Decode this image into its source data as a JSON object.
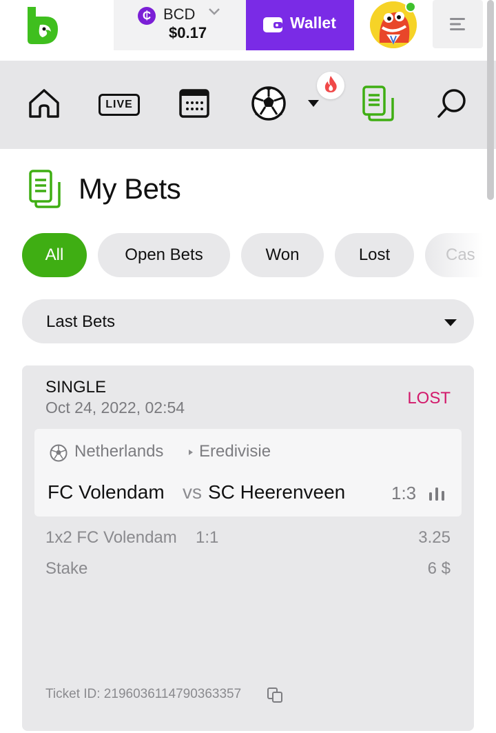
{
  "header": {
    "currency": {
      "symbol": "₵",
      "code": "BCD",
      "amount": "$0.17"
    },
    "wallet_label": "Wallet"
  },
  "nav": {
    "items": [
      "home-icon",
      "live-icon",
      "calendar-icon",
      "soccer-ball-icon",
      "dropdown-caret-icon",
      "my-bets-icon",
      "search-icon"
    ],
    "live_label": "LIVE",
    "hot_badge": "fire-icon"
  },
  "page": {
    "title": "My Bets"
  },
  "filters": {
    "chips": [
      {
        "label": "All",
        "active": true
      },
      {
        "label": "Open Bets",
        "active": false
      },
      {
        "label": "Won",
        "active": false
      },
      {
        "label": "Lost",
        "active": false
      },
      {
        "label": "Cas",
        "active": false
      }
    ],
    "active_color": "#3fae13"
  },
  "dropdown": {
    "selected": "Last Bets"
  },
  "bet": {
    "type": "SINGLE",
    "date": "Oct 24, 2022, 02:54",
    "status": "LOST",
    "status_color": "#d2196b",
    "country": "Netherlands",
    "league": "Eredivisie",
    "home_team": "FC Volendam",
    "vs": "vs",
    "away_team": "SC Heerenveen",
    "score": "1:3",
    "market": "1x2 FC Volendam",
    "pick_score": "1:1",
    "odds": "3.25",
    "stake_label": "Stake",
    "stake_value": "6 $",
    "ticket": "Ticket ID: 219603611479036335​7"
  },
  "colors": {
    "brand_green": "#3fae13",
    "wallet_purple": "#7a2be6",
    "lost_pink": "#d2196b"
  }
}
